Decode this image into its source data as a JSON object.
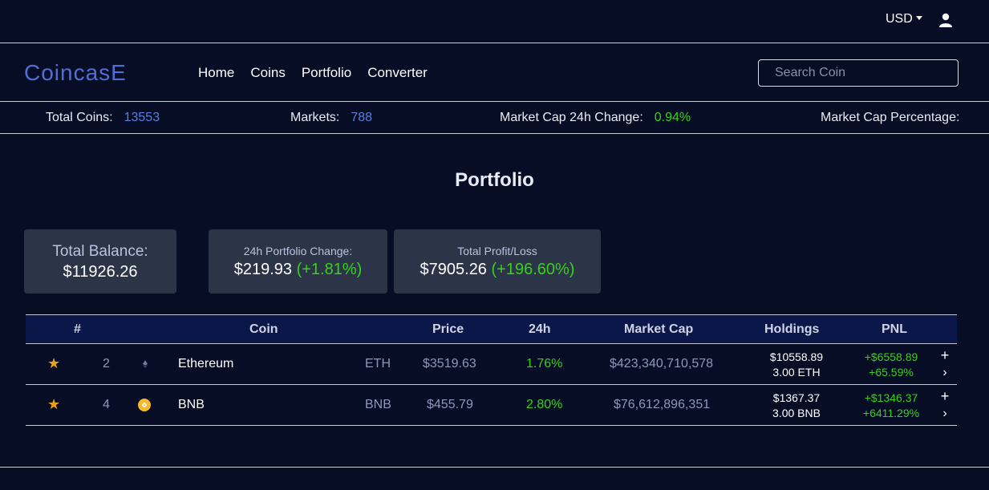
{
  "topbar": {
    "currency": "USD"
  },
  "navbar": {
    "logo": "CoincasE",
    "links": [
      "Home",
      "Coins",
      "Portfolio",
      "Converter"
    ],
    "search_placeholder": "Search Coin"
  },
  "stats": {
    "total_coins_label": "Total Coins:",
    "total_coins": "13553",
    "markets_label": "Markets:",
    "markets": "788",
    "mcap_change_label": "Market Cap 24h Change:",
    "mcap_change": "0.94%",
    "mcap_pct_label": "Market Cap Percentage:"
  },
  "page_title": "Portfolio",
  "cards": {
    "balance_label": "Total Balance:",
    "balance": "$11926.26",
    "change_label": "24h Portfolio Change:",
    "change_value": "$219.93",
    "change_pct": "(+1.81%)",
    "pnl_label": "Total Profit/Loss",
    "pnl_value": "$7905.26",
    "pnl_pct": "(+196.60%)"
  },
  "table": {
    "headers": [
      "#",
      "Coin",
      "Price",
      "24h",
      "Market Cap",
      "Holdings",
      "PNL"
    ],
    "rows": [
      {
        "rank": "2",
        "name": "Ethereum",
        "symbol": "ETH",
        "price": "$3519.63",
        "change_24h": "1.76%",
        "market_cap": "$423,340,710,578",
        "holdings_value": "$10558.89",
        "holdings_qty": "3.00 ETH",
        "pnl_value": "+$6558.89",
        "pnl_pct": "+65.59%"
      },
      {
        "rank": "4",
        "name": "BNB",
        "symbol": "BNB",
        "price": "$455.79",
        "change_24h": "2.80%",
        "market_cap": "$76,612,896,351",
        "holdings_value": "$1367.37",
        "holdings_qty": "3.00 BNB",
        "pnl_value": "+$1346.37",
        "pnl_pct": "+6411.29%"
      }
    ]
  },
  "icons": {
    "star": "star-icon",
    "eth": "ethereum-icon",
    "bnb": "bnb-icon",
    "add": "plus-icon",
    "more": "chevron-right-icon",
    "user": "user-icon"
  },
  "colors": {
    "accent": "#5b7fe0",
    "positive": "#38d11b",
    "star": "#e8a21a",
    "background": "#070d24"
  }
}
